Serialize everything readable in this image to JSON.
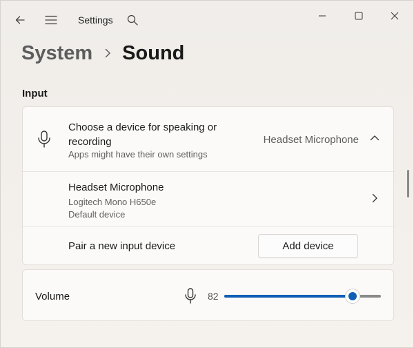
{
  "window": {
    "title": "Settings",
    "controls": [
      "minimize",
      "maximize",
      "close"
    ]
  },
  "breadcrumb": {
    "parent": "System",
    "current": "Sound"
  },
  "input_section": {
    "title": "Input",
    "choose_device": {
      "title": "Choose a device for speaking or recording",
      "subtitle": "Apps might have their own settings",
      "value": "Headset Microphone",
      "expanded": true
    },
    "device": {
      "name": "Headset Microphone",
      "model": "Logitech Mono H650e",
      "status": "Default device"
    },
    "pair": {
      "label": "Pair a new input device",
      "button_label": "Add device"
    }
  },
  "volume": {
    "label": "Volume",
    "value": 82,
    "value_text": "82"
  },
  "colors": {
    "accent": "#0f5fb7"
  }
}
